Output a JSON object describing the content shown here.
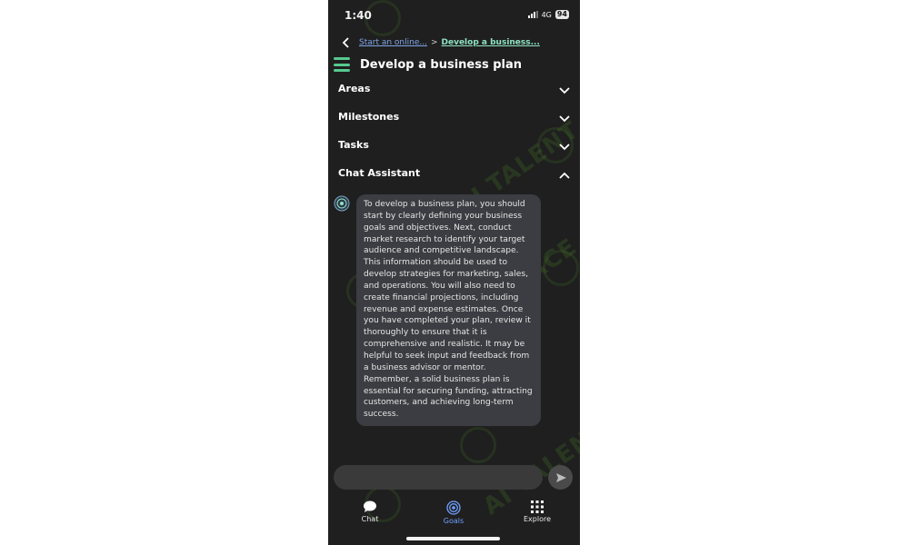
{
  "status_bar": {
    "time": "1:40",
    "network": "4G",
    "battery": "94"
  },
  "breadcrumb": {
    "parent": "Start an online...",
    "separator": ">",
    "current": "Develop a business..."
  },
  "page": {
    "title": "Develop a business plan"
  },
  "sections": [
    {
      "label": "Areas",
      "expanded": false
    },
    {
      "label": "Milestones",
      "expanded": false
    },
    {
      "label": "Tasks",
      "expanded": false
    },
    {
      "label": "Chat Assistant",
      "expanded": true
    }
  ],
  "chat": {
    "messages": [
      {
        "role": "assistant",
        "text": "To develop a business plan, you should start by clearly defining your business goals and objectives. Next, conduct market research to identify your target audience and competitive landscape. This information should be used to develop strategies for marketing, sales, and operations. You will also need to create financial projections, including revenue and expense estimates. Once you have completed your plan, review it thoroughly to ensure that it is comprehensive and realistic. It may be helpful to seek input and feedback from a business advisor or mentor. Remember, a solid business plan is essential for securing funding, attracting customers, and achieving long-term success."
      }
    ],
    "input_placeholder": ""
  },
  "bottom_nav": [
    {
      "label": "Chat",
      "icon": "chat-bubble-icon",
      "active": false
    },
    {
      "label": "Goals",
      "icon": "target-icon",
      "active": true
    },
    {
      "label": "Explore",
      "icon": "grid-icon",
      "active": false
    }
  ],
  "watermark": "AI TALENT SPACE",
  "colors": {
    "background": "#1f1f1f",
    "accent_green": "#55c98f",
    "active_nav": "#6fa0ff",
    "bubble": "#3b3d42"
  }
}
